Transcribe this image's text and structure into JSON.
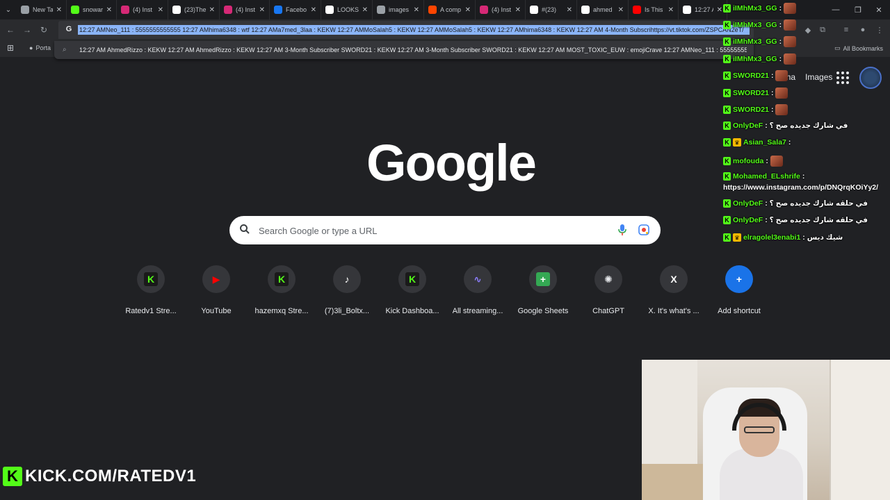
{
  "tabs": [
    {
      "title": "New Ta",
      "icon": "chrome-icon",
      "color": "#9aa0a6"
    },
    {
      "title": "snowar",
      "icon": "kick-icon",
      "color": "#53fc18"
    },
    {
      "title": "(4) Inst",
      "icon": "instagram-icon",
      "color": "#d62976"
    },
    {
      "title": "(23)The",
      "icon": "tiktok-icon",
      "color": "#ffffff"
    },
    {
      "title": "(4) Inst",
      "icon": "instagram-icon",
      "color": "#d62976"
    },
    {
      "title": "Facebo",
      "icon": "facebook-icon",
      "color": "#1877f2"
    },
    {
      "title": "LOOKS",
      "icon": "google-icon",
      "color": "#ffffff"
    },
    {
      "title": "images",
      "icon": "chrome-icon",
      "color": "#9aa0a6"
    },
    {
      "title": "A comp",
      "icon": "reddit-icon",
      "color": "#ff4500"
    },
    {
      "title": "(4) Inst",
      "icon": "instagram-icon",
      "color": "#d62976"
    },
    {
      "title": "#(23)",
      "icon": "tiktok-icon",
      "color": "#ffffff"
    },
    {
      "title": "ahmed",
      "icon": "google-icon",
      "color": "#ffffff"
    },
    {
      "title": "Is This",
      "icon": "youtube-icon",
      "color": "#ff0000"
    },
    {
      "title": "12:27 A",
      "icon": "google-icon",
      "color": "#ffffff"
    }
  ],
  "omnibox": {
    "text": "12:27 AMNeo_111 : 5555555555555 12:27 AMhima6348 : wtf 12:27 AMa7med_3laa : KEKW 12:27 AMMoSalah5 : KEKW 12:27 AMMoSalah5 : KEKW 12:27 AMhima6348 : KEKW 12:27 AM 4-Month Subscrihttps://vt.tiktok.com/ZSPCAN2eT/"
  },
  "suggestion": {
    "text": "12:27 AM AhmedRizzo : KEKW 12:27 AM AhmedRizzo : KEKW 12:27 AM 3-Month Subscriber SWORD21 : KEKW 12:27 AM 3-Month Subscriber SWORD21 : KEKW 12:27 AM MOST_TOXIC_EUW : emojiCrave 12:27 AMNeo_111 : 55555555..."
  },
  "bookmarks": {
    "item": "Porta",
    "all": "All Bookmarks"
  },
  "header": {
    "gmail": "Gma",
    "images": "Images"
  },
  "search": {
    "placeholder": "Search Google or type a URL"
  },
  "shortcuts": [
    {
      "label": "Ratedv1 Stre...",
      "icon": "kick-icon",
      "glyph": "K",
      "color": "#53fc18"
    },
    {
      "label": "YouTube",
      "icon": "youtube-icon",
      "glyph": "▶",
      "color": "#ff0000"
    },
    {
      "label": "hazemxq Stre...",
      "icon": "kick-icon",
      "glyph": "K",
      "color": "#53fc18"
    },
    {
      "label": "(7)3li_Boltx...",
      "icon": "tiktok-icon",
      "glyph": "♪",
      "color": "#ffffff"
    },
    {
      "label": "Kick Dashboa...",
      "icon": "kick-icon",
      "glyph": "K",
      "color": "#53fc18"
    },
    {
      "label": "All streaming...",
      "icon": "streaming-icon",
      "glyph": "∿",
      "color": "#8a7cf8"
    },
    {
      "label": "Google Sheets",
      "icon": "sheets-icon",
      "glyph": "+",
      "color": "#34a853"
    },
    {
      "label": "ChatGPT",
      "icon": "chatgpt-icon",
      "glyph": "✺",
      "color": "#e8eaed"
    },
    {
      "label": "X. It's what's ...",
      "icon": "x-icon",
      "glyph": "X",
      "color": "#ffffff"
    },
    {
      "label": "Add shortcut",
      "icon": "plus-icon",
      "glyph": "+",
      "color": "#ffffff"
    }
  ],
  "chat": [
    {
      "user": "iIMhMx3_GG",
      "text": ":",
      "color": "#53fc18",
      "badge": "K",
      "emote": true
    },
    {
      "user": "iIMhMx3_GG",
      "text": ":",
      "color": "#53fc18",
      "badge": "K",
      "emote": true
    },
    {
      "user": "iIMhMx3_GG",
      "text": ":",
      "color": "#53fc18",
      "badge": "K",
      "emote": true
    },
    {
      "user": "iIMhMx3_GG",
      "text": ":",
      "color": "#53fc18",
      "badge": "K",
      "emote": true
    },
    {
      "user": "SWORD21",
      "text": ":",
      "color": "#53fc18",
      "badge": "K",
      "emote": true
    },
    {
      "user": "SWORD21",
      "text": ":",
      "color": "#53fc18",
      "badge": "K",
      "emote": true
    },
    {
      "user": "SWORD21",
      "text": ":",
      "color": "#53fc18",
      "badge": "K",
      "emote": true
    },
    {
      "user": "OnlyDeF",
      "text": ": في شارك جديده صح ؟",
      "color": "#53fc18",
      "badge": "K",
      "emote": false
    },
    {
      "user": "Asian_Sala7",
      "text": ":",
      "color": "#53fc18",
      "badge": "crown",
      "emote": false
    },
    {
      "user": "mofouda",
      "text": ":",
      "color": "#53fc18",
      "badge": "K",
      "emote": true
    },
    {
      "user": "Mohamed_ELshrife",
      "text": ":",
      "color": "#53fc18",
      "badge": "K",
      "emote": false
    },
    {
      "user": "OnlyDeF",
      "text": ": في حلقه شارك جديده صح ؟",
      "color": "#53fc18",
      "badge": "K",
      "emote": false
    },
    {
      "user": "OnlyDeF",
      "text": ": في حلقه شارك جديده صح ؟",
      "color": "#53fc18",
      "badge": "K",
      "emote": false
    },
    {
      "user": "elragolel3enabi1",
      "text": ": شيك ديس",
      "color": "#53fc18",
      "badge": "crown",
      "emote": false
    }
  ],
  "chat_link": "https://www.instagram.com/p/DNQrqKOiYy2/",
  "brand": {
    "text": "KICK.COM/RATEDV1",
    "accent": "#53fc18"
  }
}
